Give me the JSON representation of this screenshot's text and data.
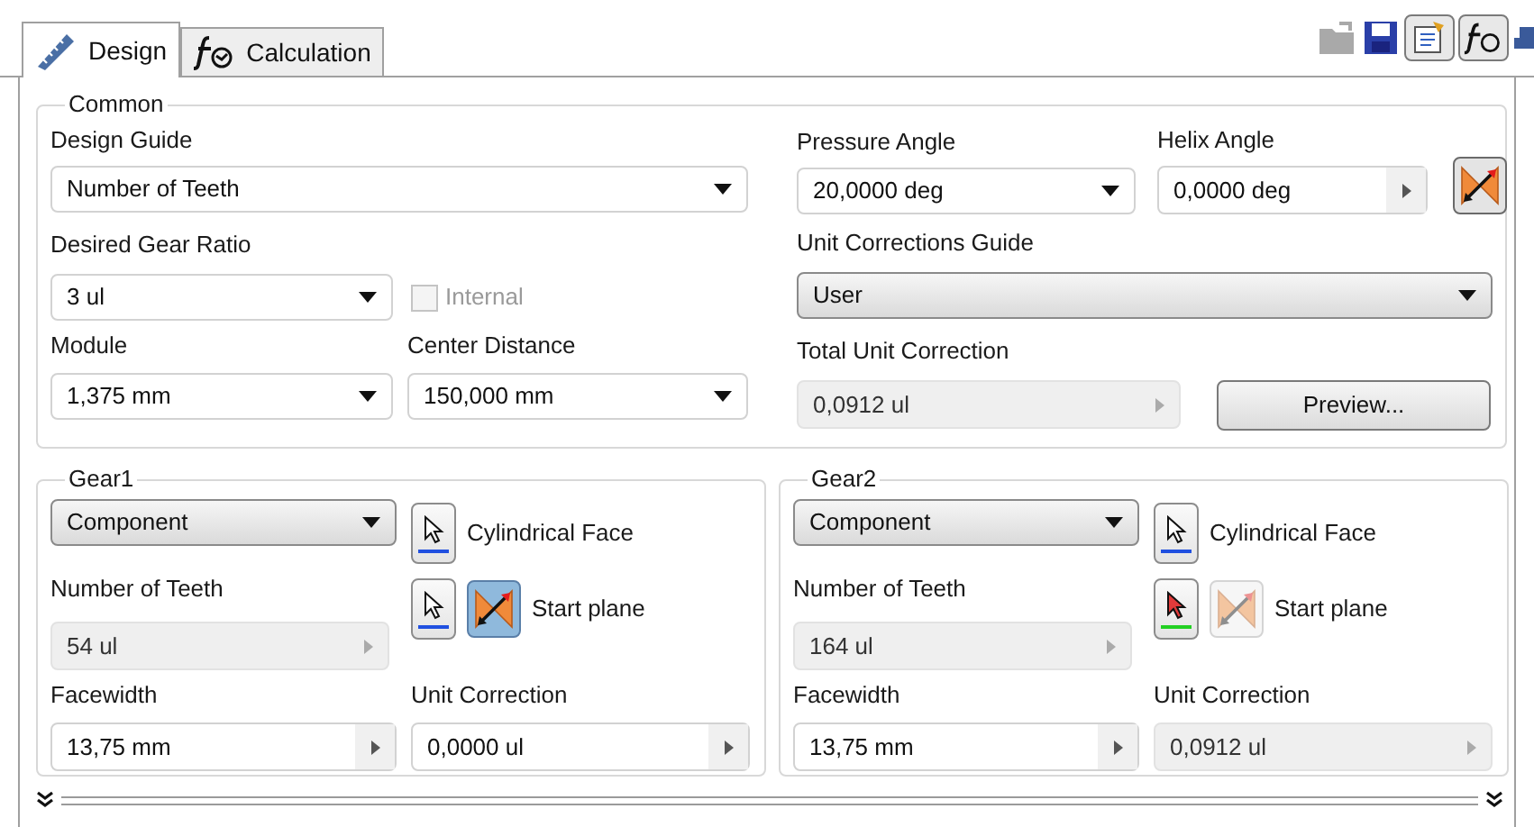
{
  "tabs": [
    {
      "label": "Design",
      "selected": true,
      "kind": "gear"
    },
    {
      "label": "Calculation",
      "selected": false,
      "kind": "fx"
    }
  ],
  "common": {
    "title": "Common",
    "design_guide": {
      "label": "Design Guide",
      "value": "Number of Teeth",
      "kind": "dropdown"
    },
    "gear_ratio": {
      "label": "Desired Gear Ratio",
      "value": "3 ul",
      "kind": "dropdown"
    },
    "internal": {
      "label": "Internal",
      "checked": false,
      "disabled": true
    },
    "module": {
      "label": "Module",
      "value": "1,375 mm",
      "kind": "dropdown"
    },
    "center_distance": {
      "label": "Center Distance",
      "value": "150,000 mm",
      "kind": "dropdown"
    },
    "pressure_angle": {
      "label": "Pressure Angle",
      "value": "20,0000 deg",
      "kind": "dropdown"
    },
    "helix_angle": {
      "label": "Helix Angle",
      "value": "0,0000 deg",
      "kind": "spin"
    },
    "unit_corrections_guide": {
      "label": "Unit Corrections Guide",
      "value": "User",
      "kind": "combo"
    },
    "total_unit_correction": {
      "label": "Total Unit Correction",
      "value": "0,0912 ul",
      "kind": "readonly"
    },
    "preview_button": "Preview..."
  },
  "gears": [
    {
      "title": "Gear1",
      "mode": {
        "value": "Component",
        "kind": "combo"
      },
      "cylindrical_face": {
        "label": "Cylindrical Face",
        "active": false
      },
      "start_plane": {
        "label": "Start plane",
        "active": false,
        "flip_enabled": true
      },
      "teeth": {
        "label": "Number of Teeth",
        "value": "54 ul",
        "kind": "readonly"
      },
      "facewidth": {
        "label": "Facewidth",
        "value": "13,75 mm",
        "kind": "spin"
      },
      "unit_correction": {
        "label": "Unit Correction",
        "value": "0,0000 ul",
        "kind": "spin"
      }
    },
    {
      "title": "Gear2",
      "mode": {
        "value": "Component",
        "kind": "combo"
      },
      "cylindrical_face": {
        "label": "Cylindrical Face",
        "active": false
      },
      "start_plane": {
        "label": "Start plane",
        "active": true,
        "flip_enabled": false
      },
      "teeth": {
        "label": "Number of Teeth",
        "value": "164 ul",
        "kind": "readonly"
      },
      "facewidth": {
        "label": "Facewidth",
        "value": "13,75 mm",
        "kind": "spin"
      },
      "unit_correction": {
        "label": "Unit Correction",
        "value": "0,0912 ul",
        "kind": "readonly"
      }
    }
  ]
}
